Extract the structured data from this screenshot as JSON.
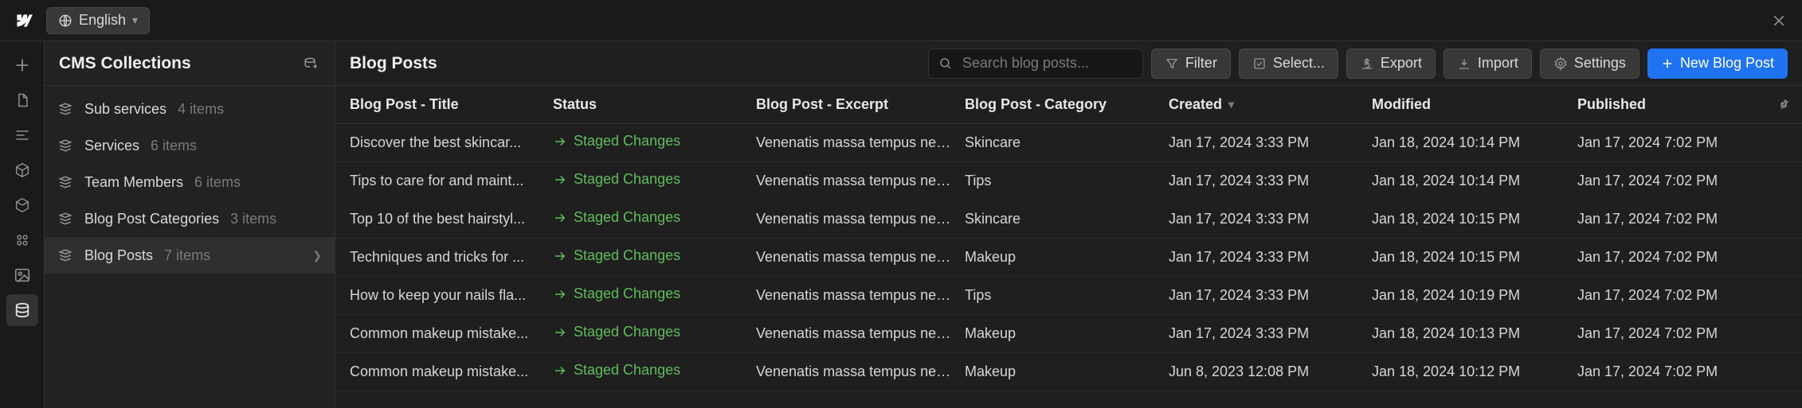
{
  "topbar": {
    "language_label": "English"
  },
  "collections": {
    "title": "CMS Collections",
    "items": [
      {
        "name": "Sub services",
        "count": "4 items",
        "selected": false
      },
      {
        "name": "Services",
        "count": "6 items",
        "selected": false
      },
      {
        "name": "Team Members",
        "count": "6 items",
        "selected": false
      },
      {
        "name": "Blog Post Categories",
        "count": "3 items",
        "selected": false
      },
      {
        "name": "Blog Posts",
        "count": "7 items",
        "selected": true
      }
    ]
  },
  "main": {
    "title": "Blog Posts",
    "search_placeholder": "Search blog posts...",
    "toolbar": {
      "filter": "Filter",
      "select": "Select...",
      "export": "Export",
      "import": "Import",
      "settings": "Settings",
      "new": "New Blog Post"
    },
    "columns": {
      "title": "Blog Post - Title",
      "status": "Status",
      "excerpt": "Blog Post - Excerpt",
      "category": "Blog Post - Category",
      "created": "Created",
      "modified": "Modified",
      "published": "Published"
    },
    "status_label": "Staged Changes",
    "rows": [
      {
        "title": "Discover the best skincar...",
        "excerpt": "Venenatis massa tempus nec ...",
        "category": "Skincare",
        "created": "Jan 17, 2024 3:33 PM",
        "modified": "Jan 18, 2024 10:14 PM",
        "published": "Jan 17, 2024 7:02 PM"
      },
      {
        "title": "Tips to care for and maint...",
        "excerpt": "Venenatis massa tempus nec ...",
        "category": "Tips",
        "created": "Jan 17, 2024 3:33 PM",
        "modified": "Jan 18, 2024 10:14 PM",
        "published": "Jan 17, 2024 7:02 PM"
      },
      {
        "title": "Top 10 of the best hairstyl...",
        "excerpt": "Venenatis massa tempus nec ...",
        "category": "Skincare",
        "created": "Jan 17, 2024 3:33 PM",
        "modified": "Jan 18, 2024 10:15 PM",
        "published": "Jan 17, 2024 7:02 PM"
      },
      {
        "title": "Techniques and tricks for ...",
        "excerpt": "Venenatis massa tempus nec ...",
        "category": "Makeup",
        "created": "Jan 17, 2024 3:33 PM",
        "modified": "Jan 18, 2024 10:15 PM",
        "published": "Jan 17, 2024 7:02 PM"
      },
      {
        "title": "How to keep your nails fla...",
        "excerpt": "Venenatis massa tempus nec ...",
        "category": "Tips",
        "created": "Jan 17, 2024 3:33 PM",
        "modified": "Jan 18, 2024 10:19 PM",
        "published": "Jan 17, 2024 7:02 PM"
      },
      {
        "title": "Common makeup mistake...",
        "excerpt": "Venenatis massa tempus nec ...",
        "category": "Makeup",
        "created": "Jan 17, 2024 3:33 PM",
        "modified": "Jan 18, 2024 10:13 PM",
        "published": "Jan 17, 2024 7:02 PM"
      },
      {
        "title": "Common makeup mistake...",
        "excerpt": "Venenatis massa tempus nec ...",
        "category": "Makeup",
        "created": "Jun 8, 2023 12:08 PM",
        "modified": "Jan 18, 2024 10:12 PM",
        "published": "Jan 17, 2024 7:02 PM"
      }
    ]
  }
}
